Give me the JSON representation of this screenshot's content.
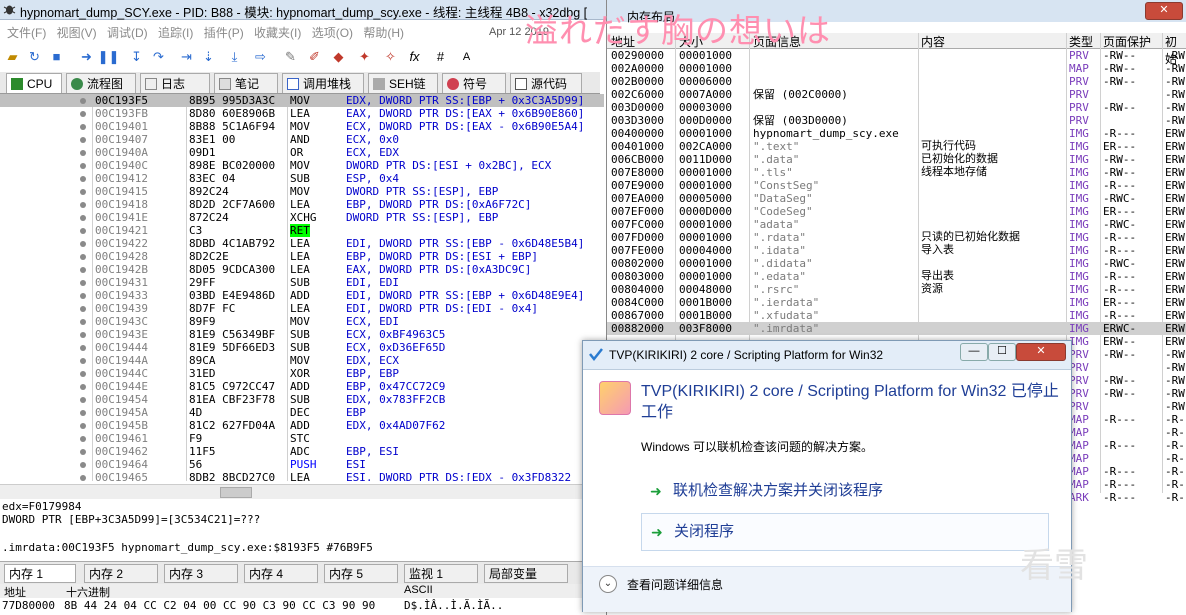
{
  "window": {
    "title": "hypnomart_dump_SCY.exe - PID: B88 - 模块: hypnomart_dump_scy.exe - 线程: 主线程 4B8 - x32dbg [",
    "overlay_text": "溢れだす胸の想いは",
    "watermark": "看雪"
  },
  "menu": {
    "items": [
      "文件(F)",
      "视图(V)",
      "调试(D)",
      "追踪(I)",
      "插件(P)",
      "收藏夹(I)",
      "选项(O)",
      "帮助(H)"
    ],
    "date": "Apr 12 2019"
  },
  "tabs": [
    {
      "label": "CPU",
      "icon": "cpu-icon",
      "active": true
    },
    {
      "label": "流程图",
      "icon": "graph-icon"
    },
    {
      "label": "日志",
      "icon": "log-icon"
    },
    {
      "label": "笔记",
      "icon": "notes-icon"
    },
    {
      "label": "调用堆栈",
      "icon": "callstack-icon"
    },
    {
      "label": "SEH链",
      "icon": "seh-icon"
    },
    {
      "label": "符号",
      "icon": "symbol-icon"
    },
    {
      "label": "源代码",
      "icon": "source-icon"
    }
  ],
  "disasm": [
    {
      "addr": "00C193F5",
      "bytes": "8B95 995D3A3C",
      "mnem": "MOV",
      "ops": "EDX, DWORD PTR SS:[EBP + 0x3C3A5D99]",
      "selected": true
    },
    {
      "addr": "00C193FB",
      "bytes": "8D80 60E8906B",
      "mnem": "LEA",
      "ops": "EAX, DWORD PTR DS:[EAX + 0x6B90E860]"
    },
    {
      "addr": "00C19401",
      "bytes": "8B88 5C1A6F94",
      "mnem": "MOV",
      "ops": "ECX, DWORD PTR DS:[EAX - 0x6B90E5A4]"
    },
    {
      "addr": "00C19407",
      "bytes": "83E1 00",
      "mnem": "AND",
      "ops": "ECX, 0x0"
    },
    {
      "addr": "00C1940A",
      "bytes": "09D1",
      "mnem": "OR",
      "ops": "ECX, EDX"
    },
    {
      "addr": "00C1940C",
      "bytes": "898E BC020000",
      "mnem": "MOV",
      "ops": "DWORD PTR DS:[ESI + 0x2BC], ECX"
    },
    {
      "addr": "00C19412",
      "bytes": "83EC 04",
      "mnem": "SUB",
      "ops": "ESP, 0x4"
    },
    {
      "addr": "00C19415",
      "bytes": "892C24",
      "mnem": "MOV",
      "ops": "DWORD PTR SS:[ESP], EBP"
    },
    {
      "addr": "00C19418",
      "bytes": "8D2D 2CF7A600",
      "mnem": "LEA",
      "ops": "EBP, DWORD PTR DS:[0xA6F72C]"
    },
    {
      "addr": "00C1941E",
      "bytes": "872C24",
      "mnem": "XCHG",
      "ops": "DWORD PTR SS:[ESP], EBP"
    },
    {
      "addr": "00C19421",
      "bytes": "C3",
      "mnem": "RET",
      "ops": ""
    },
    {
      "addr": "00C19422",
      "bytes": "8DBD 4C1AB792",
      "mnem": "LEA",
      "ops": "EDI, DWORD PTR SS:[EBP - 0x6D48E5B4]"
    },
    {
      "addr": "00C19428",
      "bytes": "8D2C2E",
      "mnem": "LEA",
      "ops": "EBP, DWORD PTR DS:[ESI + EBP]"
    },
    {
      "addr": "00C1942B",
      "bytes": "8D05 9CDCA300",
      "mnem": "LEA",
      "ops": "EAX, DWORD PTR DS:[0xA3DC9C]"
    },
    {
      "addr": "00C19431",
      "bytes": "29FF",
      "mnem": "SUB",
      "ops": "EDI, EDI"
    },
    {
      "addr": "00C19433",
      "bytes": "03BD E4E9486D",
      "mnem": "ADD",
      "ops": "EDI, DWORD PTR SS:[EBP + 0x6D48E9E4]"
    },
    {
      "addr": "00C19439",
      "bytes": "8D7F FC",
      "mnem": "LEA",
      "ops": "EDI, DWORD PTR DS:[EDI - 0x4]"
    },
    {
      "addr": "00C1943C",
      "bytes": "89F9",
      "mnem": "MOV",
      "ops": "ECX, EDI"
    },
    {
      "addr": "00C1943E",
      "bytes": "81E9 C56349BF",
      "mnem": "SUB",
      "ops": "ECX, 0xBF4963C5"
    },
    {
      "addr": "00C19444",
      "bytes": "81E9 5DF66ED3",
      "mnem": "SUB",
      "ops": "ECX, 0xD36EF65D"
    },
    {
      "addr": "00C1944A",
      "bytes": "89CA",
      "mnem": "MOV",
      "ops": "EDX, ECX"
    },
    {
      "addr": "00C1944C",
      "bytes": "31ED",
      "mnem": "XOR",
      "ops": "EBP, EBP"
    },
    {
      "addr": "00C1944E",
      "bytes": "81C5 C972CC47",
      "mnem": "ADD",
      "ops": "EBP, 0x47CC72C9"
    },
    {
      "addr": "00C19454",
      "bytes": "81EA CBF23F78",
      "mnem": "SUB",
      "ops": "EDX, 0x783FF2CB"
    },
    {
      "addr": "00C1945A",
      "bytes": "4D",
      "mnem": "DEC",
      "ops": "EBP"
    },
    {
      "addr": "00C1945B",
      "bytes": "81C2 627FD04A",
      "mnem": "ADD",
      "ops": "EDX, 0x4AD07F62"
    },
    {
      "addr": "00C19461",
      "bytes": "F9",
      "mnem": "STC",
      "ops": ""
    },
    {
      "addr": "00C19462",
      "bytes": "11F5",
      "mnem": "ADC",
      "ops": "EBP, ESI"
    },
    {
      "addr": "00C19464",
      "bytes": "56",
      "mnem": "PUSH",
      "ops": "ESI"
    },
    {
      "addr": "00C19465",
      "bytes": "8DB2 8BCD27C0",
      "mnem": "LEA",
      "ops": "ESI, DWORD PTR DS:[EDX - 0x3FD8322"
    }
  ],
  "info": {
    "line1": "edx=F0179984",
    "line2": "DWORD PTR [EBP+3C3A5D99]=[3C534C21]=???",
    "line3": ".imrdata:00C193F5 hypnomart_dump_scy.exe:$8193F5 #76B9F5"
  },
  "bottom_tabs": [
    "内存 1",
    "内存 2",
    "内存 3",
    "内存 4",
    "内存 5",
    "监视 1",
    "局部变量"
  ],
  "dump": {
    "col_addr": "地址",
    "col_hex": "十六进制",
    "col_ascii": "ASCII",
    "row_addr": "77D80000",
    "row_hex": "8B 44 24 04 CC C2 04 00 CC 90 C3 90 CC C3 90 90",
    "row_ascii": "D$.ÌÂ..Ì.Ã.ÌÃ.."
  },
  "memmap": {
    "title": "内存布局",
    "headers": [
      "地址",
      "大小",
      "页面信息",
      "内容",
      "类型",
      "页面保护",
      "初始"
    ],
    "rows": [
      [
        "00290000",
        "00001000",
        "",
        "",
        "PRV",
        "-RW--",
        "-RW"
      ],
      [
        "002A0000",
        "00001000",
        "",
        "",
        "MAP",
        "-RW--",
        "-RW"
      ],
      [
        "002B0000",
        "00006000",
        "",
        "",
        "PRV",
        "-RW--",
        "-RW"
      ],
      [
        "002C6000",
        "0007A000",
        "保留 (002C0000)",
        "",
        "PRV",
        "",
        "-RW"
      ],
      [
        "003D0000",
        "00003000",
        "",
        "",
        "PRV",
        "-RW--",
        "-RW"
      ],
      [
        "003D3000",
        "000D0000",
        "保留 (003D0000)",
        "",
        "PRV",
        "",
        "-RW"
      ],
      [
        "00400000",
        "00001000",
        "hypnomart_dump_scy.exe",
        "",
        "IMG",
        "-R---",
        "ERW"
      ],
      [
        "00401000",
        "002CA000",
        "\".text\"",
        "可执行代码",
        "IMG",
        "ER---",
        "ERW"
      ],
      [
        "006CB000",
        "0011D000",
        "\".data\"",
        "已初始化的数据",
        "IMG",
        "-RW--",
        "ERW"
      ],
      [
        "007E8000",
        "00001000",
        "\".tls\"",
        "线程本地存储",
        "IMG",
        "-RW--",
        "ERW"
      ],
      [
        "007E9000",
        "00001000",
        "\"ConstSeg\"",
        "",
        "IMG",
        "-R---",
        "ERW"
      ],
      [
        "007EA000",
        "00005000",
        "\"DataSeg\"",
        "",
        "IMG",
        "-RWC-",
        "ERW"
      ],
      [
        "007EF000",
        "0000D000",
        "\"CodeSeg\"",
        "",
        "IMG",
        "ER---",
        "ERW"
      ],
      [
        "007FC000",
        "00001000",
        "\"adata\"",
        "",
        "IMG",
        "-RWC-",
        "ERW"
      ],
      [
        "007FD000",
        "00001000",
        "\".rdata\"",
        "只读的已初始化数据",
        "IMG",
        "-R---",
        "ERW"
      ],
      [
        "007FE000",
        "00004000",
        "\".idata\"",
        "导入表",
        "IMG",
        "-R---",
        "ERW"
      ],
      [
        "00802000",
        "00001000",
        "\".didata\"",
        "",
        "IMG",
        "-RWC-",
        "ERW"
      ],
      [
        "00803000",
        "00001000",
        "\".edata\"",
        "导出表",
        "IMG",
        "-R---",
        "ERW"
      ],
      [
        "00804000",
        "00048000",
        "\".rsrc\"",
        "资源",
        "IMG",
        "-R---",
        "ERW"
      ],
      [
        "0084C000",
        "0001B000",
        "\".ierdata\"",
        "",
        "IMG",
        "ER---",
        "ERW"
      ],
      [
        "00867000",
        "0001B000",
        "\".xfudata\"",
        "",
        "IMG",
        "-R---",
        "ERW"
      ],
      [
        "00882000",
        "003F8000",
        "\".imrdata\"",
        "",
        "IMG",
        "ERWC-",
        "ERW"
      ],
      [
        "",
        "",
        "",
        "",
        "IMG",
        "ERW--",
        "ERW"
      ],
      [
        "",
        "",
        "",
        "",
        "PRV",
        "-RW--",
        "-RW"
      ],
      [
        "",
        "",
        "",
        "",
        "PRV",
        "",
        "-RW"
      ],
      [
        "",
        "",
        "",
        "",
        "PRV",
        "-RW--",
        "-RW"
      ],
      [
        "",
        "",
        "",
        "",
        "PRV",
        "-RW--",
        "-RW"
      ],
      [
        "",
        "",
        "",
        "",
        "PRV",
        "",
        "-RW"
      ],
      [
        "",
        "",
        "",
        "",
        "MAP",
        "-R---",
        "-R-"
      ],
      [
        "",
        "",
        "",
        "",
        "MAP",
        "",
        "-R-"
      ],
      [
        "",
        "",
        "",
        "",
        "MAP",
        "-R---",
        "-R-"
      ],
      [
        "",
        "",
        "",
        "",
        "MAP",
        "",
        "-R-"
      ],
      [
        "",
        "",
        "",
        "",
        "MAP",
        "-R---",
        "-R-"
      ],
      [
        "",
        "",
        "",
        "",
        "MAP",
        "-R---",
        "-R-"
      ],
      [
        "",
        "",
        "",
        "",
        "ARK",
        "-R---",
        "-R-"
      ]
    ]
  },
  "dialog": {
    "title": "TVP(KIRIKIRI) 2 core / Scripting Platform for Win32",
    "heading": "TVP(KIRIKIRI) 2 core / Scripting Platform for Win32 已停止工作",
    "body": "Windows 可以联机检查该问题的解决方案。",
    "cmd1": "联机检查解决方案并关闭该程序",
    "cmd2": "关闭程序",
    "footer": "查看问题详细信息"
  }
}
